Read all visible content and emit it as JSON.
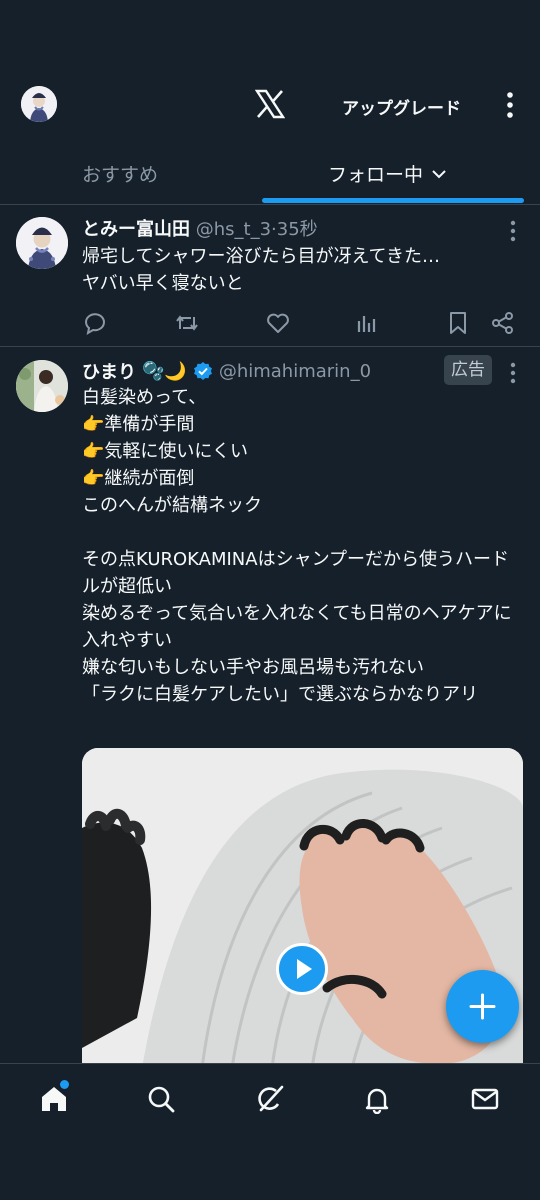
{
  "header": {
    "upgrade_label": "アップグレード",
    "tabs": [
      {
        "label": "おすすめ",
        "active": false
      },
      {
        "label": "フォロー中",
        "active": true
      }
    ]
  },
  "post1": {
    "display_name": "とみー富山田",
    "handle": "@hs_t_3",
    "separator": "·",
    "time": "35秒",
    "text": "帰宅してシャワー浴びたら目が冴えてきた…\nヤバい早く寝ないと"
  },
  "post2": {
    "display_name": "ひまり",
    "emoji": "🫧🌙",
    "handle": "@himahimarin_0",
    "ad_label": "広告",
    "text": "白髪染めって、\n👉準備が手間\n👉気軽に使いにくい\n👉継続が面倒\nこのへんが結構ネック\n\nその点KUROKAMINAはシャンプーだから使うハードルが超低い\n染めるぞって気合いを入れなくても日常のヘアケアに入れやすい\n嫌な匂いもしない手やお風呂場も汚れない\n「ラクに白髪ケアしたい」で選ぶならかなりアリ"
  },
  "icons": {
    "accent": "#1d9bf0",
    "verified": "#1d9bf0",
    "background": "#15202b"
  },
  "bottom_nav": [
    "home-icon",
    "search-icon",
    "grok-icon",
    "notifications-icon",
    "messages-icon"
  ]
}
